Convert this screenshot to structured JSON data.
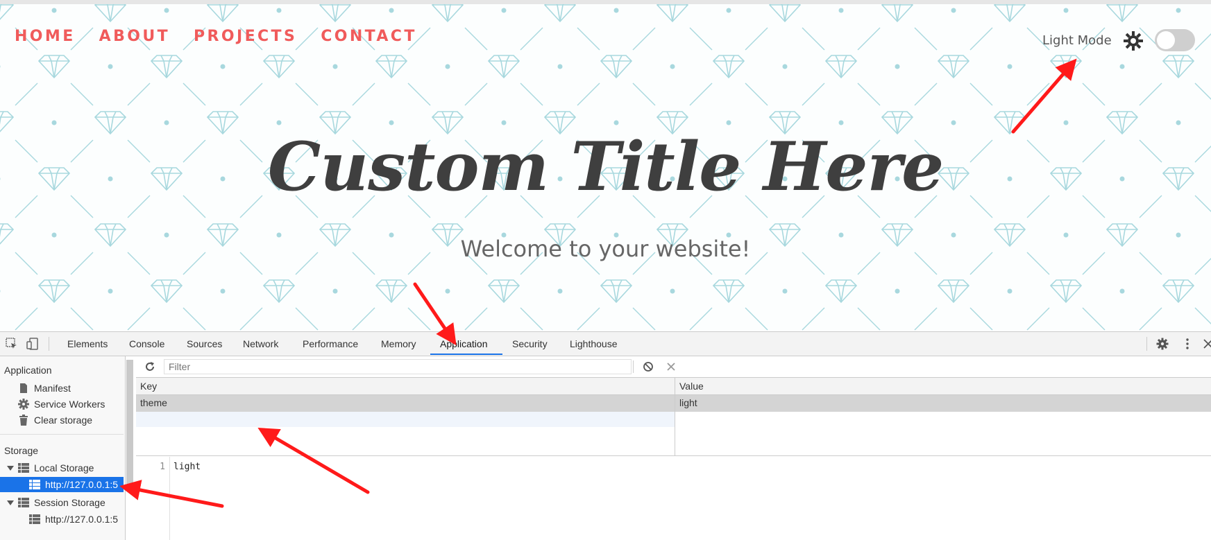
{
  "site": {
    "nav": [
      "HOME",
      "ABOUT",
      "PROJECTS",
      "CONTACT"
    ],
    "theme_label": "Light Mode",
    "theme_toggle_on": false,
    "title": "Custom Title Here",
    "subtitle": "Welcome to your website!",
    "pattern_color": "#a8d8de",
    "accent_color": "#f05b5b"
  },
  "devtools": {
    "tabs": [
      "Elements",
      "Console",
      "Sources",
      "Network",
      "Performance",
      "Memory",
      "Application",
      "Security",
      "Lighthouse"
    ],
    "active_tab": "Application",
    "sidebar": {
      "application_header": "Application",
      "application_items": [
        "Manifest",
        "Service Workers",
        "Clear storage"
      ],
      "storage_header": "Storage",
      "local_storage": "Local Storage",
      "local_storage_origin": "http://127.0.0.1:5",
      "session_storage": "Session Storage",
      "session_storage_origin": "http://127.0.0.1:5"
    },
    "filter_placeholder": "Filter",
    "table": {
      "columns": [
        "Key",
        "Value"
      ],
      "rows": [
        {
          "key": "theme",
          "value": "light"
        }
      ]
    },
    "preview": {
      "line_number": "1",
      "text": "light"
    }
  }
}
